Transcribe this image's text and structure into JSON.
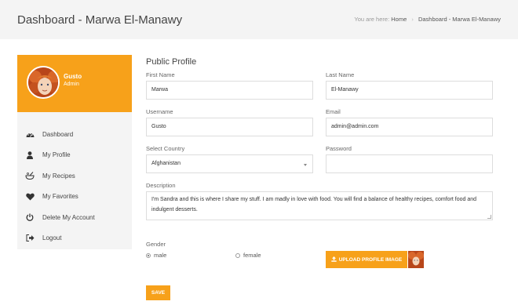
{
  "header": {
    "page_title": "Dashboard - Marwa El-Manawy",
    "breadcrumb_prefix": "You are here:",
    "breadcrumb_home": "Home",
    "breadcrumb_separator": "›",
    "breadcrumb_current": "Dashboard - Marwa El-Manawy"
  },
  "sidebar": {
    "profile": {
      "name": "Gusto",
      "role": "Admin"
    },
    "items": [
      {
        "label": "Dashboard",
        "icon": "dashboard-gauge-icon"
      },
      {
        "label": "My Profile",
        "icon": "user-icon"
      },
      {
        "label": "My Recipes",
        "icon": "bowl-spoon-icon"
      },
      {
        "label": "My Favorites",
        "icon": "heart-icon"
      },
      {
        "label": "Delete My Account",
        "icon": "power-icon"
      },
      {
        "label": "Logout",
        "icon": "sign-out-icon"
      }
    ]
  },
  "form": {
    "title": "Public Profile",
    "first_name": {
      "label": "First Name",
      "value": "Marwa"
    },
    "last_name": {
      "label": "Last Name",
      "value": "El-Manawy"
    },
    "username": {
      "label": "Username",
      "value": "Gusto"
    },
    "email": {
      "label": "Email",
      "value": "admin@admin.com"
    },
    "country": {
      "label": "Select Country",
      "value": "Afghanistan"
    },
    "password": {
      "label": "Password",
      "value": ""
    },
    "description": {
      "label": "Description",
      "value": "I'm Sandra and this is where I share my stuff. I am madly in love with food. You will find a balance of healthy recipes, comfort food and indulgent desserts."
    },
    "gender": {
      "label": "Gender",
      "male": "male",
      "female": "female",
      "selected": "male"
    },
    "upload_label": "UPLOAD PROFILE IMAGE",
    "save_label": "SAVE"
  },
  "colors": {
    "accent": "#f7a11a",
    "topbar": "#f4f4f4",
    "sidebar": "#f4f4f4"
  }
}
